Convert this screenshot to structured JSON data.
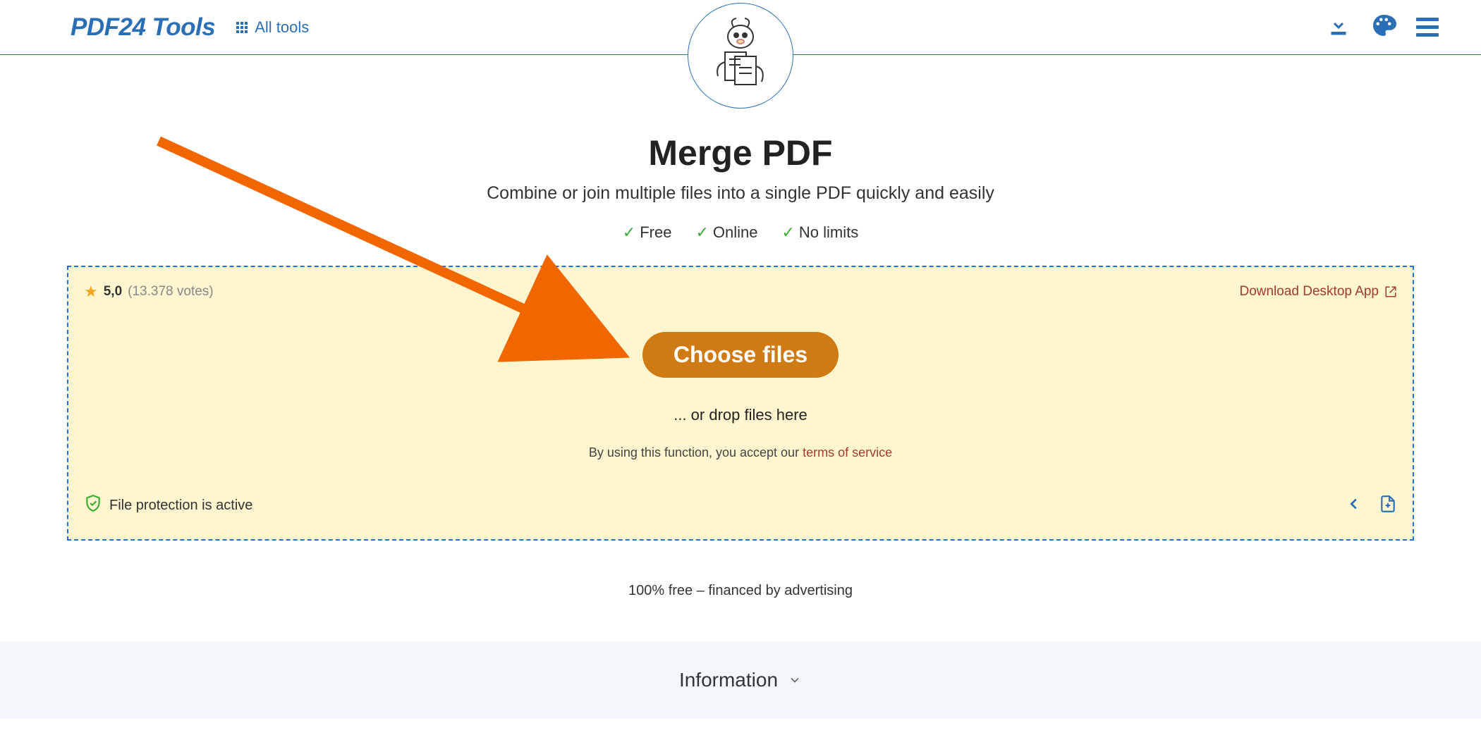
{
  "header": {
    "brand": "PDF24 Tools",
    "all_tools": "All tools"
  },
  "page": {
    "title": "Merge PDF",
    "subtitle": "Combine or join multiple files into a single PDF quickly and easily",
    "bullets": [
      "Free",
      "Online",
      "No limits"
    ]
  },
  "dropzone": {
    "rating_score": "5,0",
    "rating_votes": "(13.378 votes)",
    "desktop_link": "Download Desktop App",
    "choose_button": "Choose files",
    "drop_hint": "... or drop files here",
    "tos_prefix": "By using this function, you accept our ",
    "tos_link": "terms of service",
    "protection": "File protection is active"
  },
  "footer": {
    "ad_note": "100% free – financed by advertising",
    "info_label": "Information"
  }
}
